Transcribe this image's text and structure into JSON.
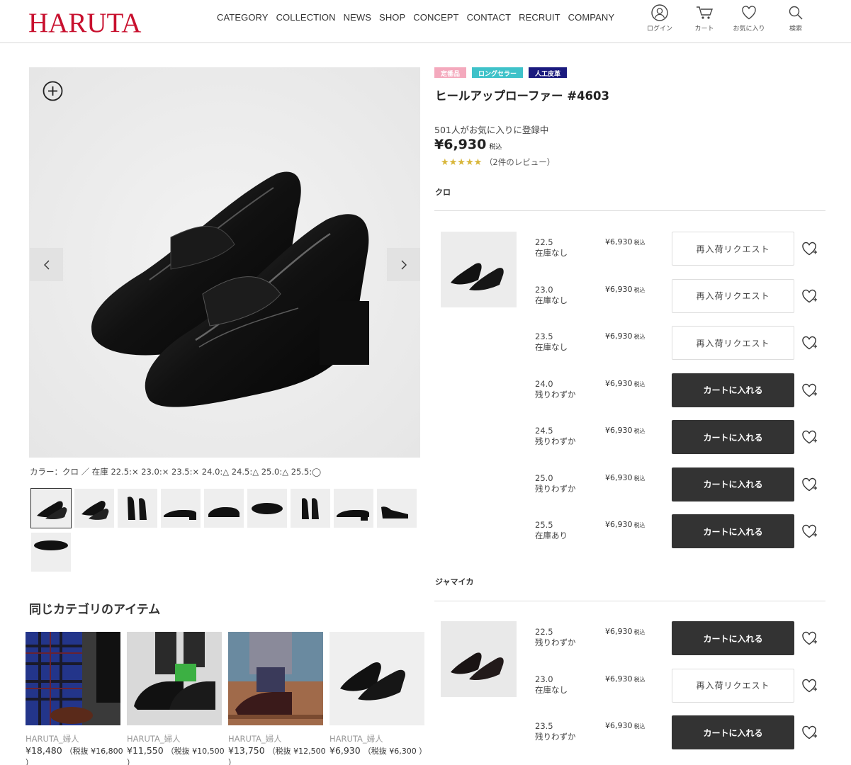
{
  "header": {
    "logo": "HARUTA",
    "nav": [
      "CATEGORY",
      "COLLECTION",
      "NEWS",
      "SHOP",
      "CONCEPT",
      "CONTACT",
      "RECRUIT",
      "COMPANY"
    ],
    "icons": [
      {
        "name": "user-icon",
        "label": "ログイン"
      },
      {
        "name": "cart-icon",
        "label": "カート"
      },
      {
        "name": "heart-icon",
        "label": "お気に入り"
      },
      {
        "name": "search-icon",
        "label": "検索"
      }
    ]
  },
  "gallery": {
    "stock_line": "カラー：クロ ／ 在庫 22.5:× 23.0:× 23.5:× 24.0:△ 24.5:△ 25.0:△ 25.5:◯",
    "thumb_count": 10
  },
  "product": {
    "badges": [
      {
        "label": "定番品",
        "color": "#f4a9bd"
      },
      {
        "label": "ロングセラー",
        "color": "#3fc2c9"
      },
      {
        "label": "人工皮革",
        "color": "#1a1a7e"
      }
    ],
    "title": "ヒールアップローファー #4603",
    "fav_count": "501人がお気に入りに登録中",
    "price": "¥6,930",
    "price_tax": "税込",
    "stars": "★★★★★",
    "reviews": "（2件のレビュー）"
  },
  "variants": [
    {
      "color": "クロ",
      "rows": [
        {
          "size": "22.5",
          "stock": "在庫なし",
          "price": "¥6,930",
          "tax": "税込",
          "button": "再入荷リクエスト",
          "type": "light"
        },
        {
          "size": "23.0",
          "stock": "在庫なし",
          "price": "¥6,930",
          "tax": "税込",
          "button": "再入荷リクエスト",
          "type": "light"
        },
        {
          "size": "23.5",
          "stock": "在庫なし",
          "price": "¥6,930",
          "tax": "税込",
          "button": "再入荷リクエスト",
          "type": "light"
        },
        {
          "size": "24.0",
          "stock": "残りわずか",
          "price": "¥6,930",
          "tax": "税込",
          "button": "カートに入れる",
          "type": "dark"
        },
        {
          "size": "24.5",
          "stock": "残りわずか",
          "price": "¥6,930",
          "tax": "税込",
          "button": "カートに入れる",
          "type": "dark"
        },
        {
          "size": "25.0",
          "stock": "残りわずか",
          "price": "¥6,930",
          "tax": "税込",
          "button": "カートに入れる",
          "type": "dark"
        },
        {
          "size": "25.5",
          "stock": "在庫あり",
          "price": "¥6,930",
          "tax": "税込",
          "button": "カートに入れる",
          "type": "dark"
        }
      ]
    },
    {
      "color": "ジャマイカ",
      "rows": [
        {
          "size": "22.5",
          "stock": "残りわずか",
          "price": "¥6,930",
          "tax": "税込",
          "button": "カートに入れる",
          "type": "dark"
        },
        {
          "size": "23.0",
          "stock": "在庫なし",
          "price": "¥6,930",
          "tax": "税込",
          "button": "再入荷リクエスト",
          "type": "light"
        },
        {
          "size": "23.5",
          "stock": "残りわずか",
          "price": "¥6,930",
          "tax": "税込",
          "button": "カートに入れる",
          "type": "dark"
        }
      ]
    }
  ],
  "related": {
    "title": "同じカテゴリのアイテム",
    "items": [
      {
        "brand": "HARUTA_婦人",
        "price": "¥18,480",
        "sub": "（税抜 ¥16,800",
        "tail": "）"
      },
      {
        "brand": "HARUTA_婦人",
        "price": "¥11,550",
        "sub": "（税抜 ¥10,500",
        "tail": "）"
      },
      {
        "brand": "HARUTA_婦人",
        "price": "¥13,750",
        "sub": "（税抜 ¥12,500",
        "tail": "）"
      },
      {
        "brand": "HARUTA_婦人",
        "price": "¥6,930",
        "sub": "（税抜 ¥6,300 ）",
        "tail": ""
      }
    ]
  }
}
